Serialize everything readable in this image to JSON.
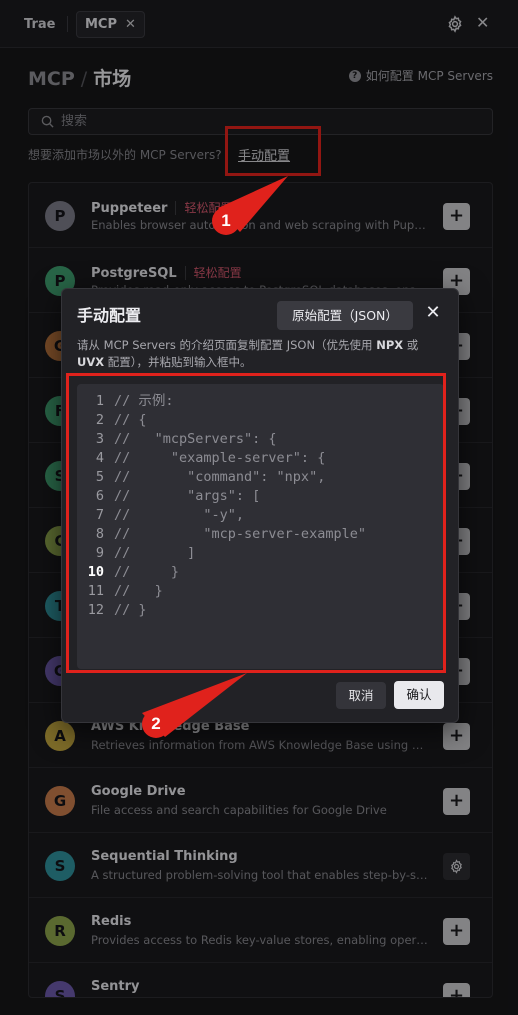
{
  "tabs": {
    "trae": "Trae",
    "mcp": "MCP",
    "mcp_close": "✕"
  },
  "header": {
    "crumb_root": "MCP",
    "crumb_sep": "/",
    "crumb_current": "市场",
    "help": "如何配置 MCP Servers"
  },
  "search": {
    "placeholder": "搜索"
  },
  "add_prompt": {
    "text": "想要添加市场以外的 MCP Servers?",
    "link": "手动配置"
  },
  "servers": [
    {
      "letter": "P",
      "name": "Puppeteer",
      "badge": "轻松配置",
      "desc": "Enables browser automation and web scraping with Puppeteer...",
      "color": "#7a7a86",
      "action": "+"
    },
    {
      "letter": "P",
      "name": "PostgreSQL",
      "badge": "轻松配置",
      "desc": "Provides read-only access to PostgreSQL databases, enabling...",
      "color": "#3e9c6e",
      "action": "+"
    },
    {
      "letter": "G",
      "name": "",
      "badge": "",
      "desc": "",
      "color": "#b8733d",
      "action": "+"
    },
    {
      "letter": "F",
      "name": "",
      "badge": "",
      "desc": "",
      "color": "#3e9c6e",
      "action": "+"
    },
    {
      "letter": "S",
      "name": "",
      "badge": "",
      "desc": "",
      "color": "#3e9c6e",
      "action": "+"
    },
    {
      "letter": "C",
      "name": "",
      "badge": "",
      "desc": "",
      "color": "#8aa14a",
      "action": "+"
    },
    {
      "letter": "T",
      "name": "",
      "badge": "",
      "desc": "",
      "color": "#2f8f9a",
      "action": "+"
    },
    {
      "letter": "G",
      "name": "",
      "badge": "",
      "desc": "",
      "color": "#6a58a8",
      "action": "+"
    },
    {
      "letter": "A",
      "name": "AWS Knowledge Base",
      "badge": "",
      "desc": "Retrieves information from AWS Knowledge Base using Bedroc...",
      "color": "#c2a640",
      "action": "+"
    },
    {
      "letter": "G",
      "name": "Google Drive",
      "badge": "",
      "desc": "File access and search capabilities for Google Drive",
      "color": "#c57a4a",
      "action": "+"
    },
    {
      "letter": "S",
      "name": "Sequential Thinking",
      "badge": "",
      "desc": "A structured problem-solving tool that enables step-by-step a...",
      "color": "#2f8f9a",
      "action": "settings"
    },
    {
      "letter": "R",
      "name": "Redis",
      "badge": "",
      "desc": "Provides access to Redis key-value stores, enabling operations ...",
      "color": "#8aa14a",
      "action": "+"
    },
    {
      "letter": "S",
      "name": "Sentry",
      "badge": "",
      "desc": "",
      "color": "#6a58a8",
      "action": "+"
    }
  ],
  "modal": {
    "title": "手动配置",
    "json_button": "原始配置（JSON）",
    "close": "✕",
    "desc_pre": "请从 MCP Servers 的介绍页面复制配置 JSON（优先使用 ",
    "desc_npx": "NPX",
    "desc_mid": " 或 ",
    "desc_uvx": "UVX",
    "desc_post": " 配置），并粘贴到输入框中。",
    "code_lines": [
      "// 示例:",
      "// {",
      "//   \"mcpServers\": {",
      "//     \"example-server\": {",
      "//       \"command\": \"npx\",",
      "//       \"args\": [",
      "//         \"-y\",",
      "//         \"mcp-server-example\"",
      "//       ]",
      "//     }",
      "//   }",
      "// }"
    ],
    "active_line": 10,
    "cancel": "取消",
    "confirm": "确认"
  },
  "callouts": {
    "first": "1",
    "second": "2"
  },
  "colors": {
    "highlight": "#e0221c",
    "badge": "#d1576c"
  }
}
